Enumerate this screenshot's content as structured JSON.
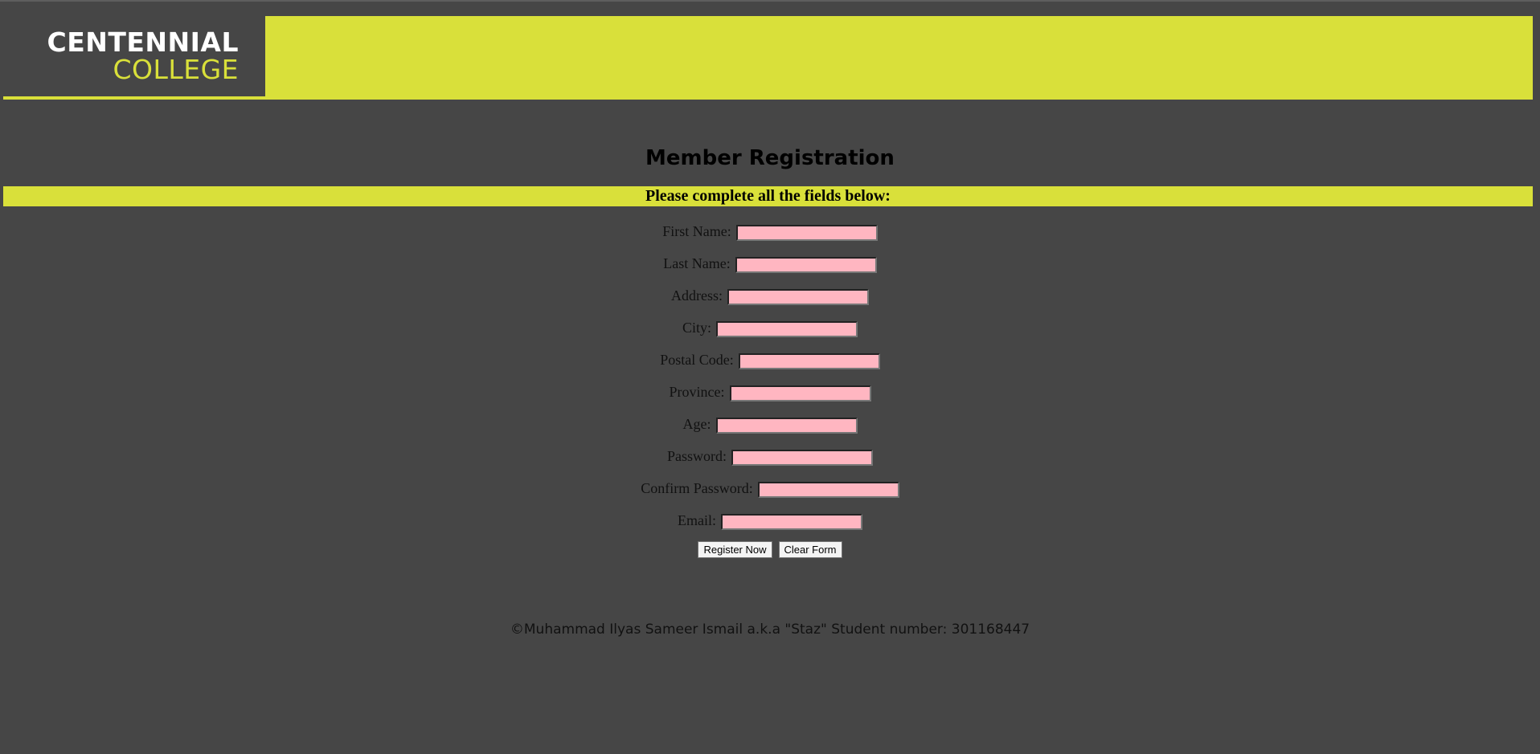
{
  "header": {
    "logo_line1": "CENTENNIAL",
    "logo_line2": "COLLEGE",
    "brand_color": "#d9e03a",
    "background_color": "#464646"
  },
  "title": "Member Registration",
  "banner": "Please complete all the fields below:",
  "form": {
    "fields": [
      {
        "label": "First Name:",
        "value": ""
      },
      {
        "label": "Last Name:",
        "value": ""
      },
      {
        "label": "Address:",
        "value": ""
      },
      {
        "label": "City:",
        "value": ""
      },
      {
        "label": "Postal Code:",
        "value": ""
      },
      {
        "label": "Province:",
        "value": ""
      },
      {
        "label": "Age:",
        "value": ""
      },
      {
        "label": "Password:",
        "value": ""
      },
      {
        "label": "Confirm Password:",
        "value": ""
      },
      {
        "label": "Email:",
        "value": ""
      }
    ],
    "input_color": "#ffb6c1",
    "register_label": "Register Now",
    "clear_label": "Clear Form"
  },
  "footer": "©Muhammad Ilyas Sameer Ismail a.k.a \"Staz\" Student number: 301168447"
}
